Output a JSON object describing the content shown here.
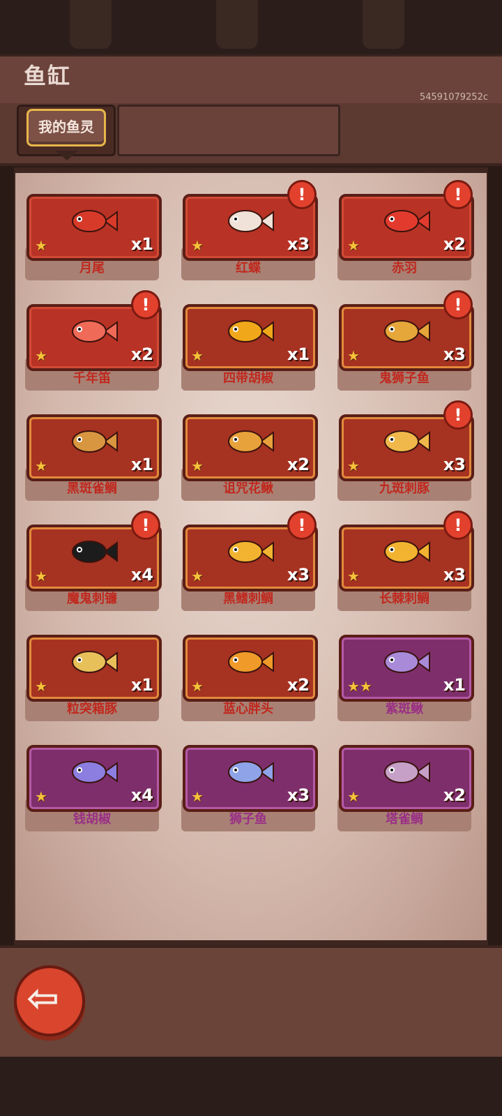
{
  "header": {
    "title": "鱼缸",
    "id": "54591079252c"
  },
  "tabs": [
    {
      "label": "我的鱼灵"
    }
  ],
  "fish": [
    {
      "name": "月尾",
      "count": "x1",
      "stars": "★",
      "theme": "red",
      "alert": false,
      "color": "#d83a2a"
    },
    {
      "name": "红蝶",
      "count": "x3",
      "stars": "★",
      "theme": "red",
      "alert": true,
      "color": "#f0e2d8"
    },
    {
      "name": "赤羽",
      "count": "x2",
      "stars": "★",
      "theme": "red",
      "alert": true,
      "color": "#e23b2e"
    },
    {
      "name": "千年笛",
      "count": "x2",
      "stars": "★",
      "theme": "red",
      "alert": true,
      "color": "#f06a58"
    },
    {
      "name": "四带胡椒",
      "count": "x1",
      "stars": "★",
      "theme": "orange",
      "alert": false,
      "color": "#f0a81a"
    },
    {
      "name": "鬼狮子鱼",
      "count": "x3",
      "stars": "★",
      "theme": "orange",
      "alert": true,
      "color": "#e6a73a"
    },
    {
      "name": "黑斑雀鲷",
      "count": "x1",
      "stars": "★",
      "theme": "orange",
      "alert": false,
      "color": "#d99640"
    },
    {
      "name": "诅咒花鳅",
      "count": "x2",
      "stars": "★",
      "theme": "orange",
      "alert": false,
      "color": "#e8a23b"
    },
    {
      "name": "九斑刺豚",
      "count": "x3",
      "stars": "★",
      "theme": "orange",
      "alert": true,
      "color": "#f0b84a"
    },
    {
      "name": "魔鬼刺镰",
      "count": "x4",
      "stars": "★",
      "theme": "orange",
      "alert": true,
      "color": "#1c1c1c"
    },
    {
      "name": "黑鳍刺鲷",
      "count": "x3",
      "stars": "★",
      "theme": "orange",
      "alert": true,
      "color": "#f2b430"
    },
    {
      "name": "长棘刺鲷",
      "count": "x3",
      "stars": "★",
      "theme": "orange",
      "alert": true,
      "color": "#f2b430"
    },
    {
      "name": "粒突箱豚",
      "count": "x1",
      "stars": "★",
      "theme": "orange",
      "alert": false,
      "color": "#e8c05a"
    },
    {
      "name": "蓝心胖头",
      "count": "x2",
      "stars": "★",
      "theme": "orange",
      "alert": false,
      "color": "#f09a2a"
    },
    {
      "name": "紫斑鳅",
      "count": "x1",
      "stars": "★★",
      "theme": "purple",
      "alert": false,
      "color": "#a98ad9"
    },
    {
      "name": "钱胡椒",
      "count": "x4",
      "stars": "★",
      "theme": "purple",
      "alert": false,
      "color": "#8c7ee0"
    },
    {
      "name": "狮子鱼",
      "count": "x3",
      "stars": "★",
      "theme": "purple",
      "alert": false,
      "color": "#8fa3e8"
    },
    {
      "name": "塔雀鲷",
      "count": "x2",
      "stars": "★",
      "theme": "purple",
      "alert": false,
      "color": "#c7a0c8"
    }
  ],
  "footer": {
    "back_icon": "back-arrow-icon"
  }
}
